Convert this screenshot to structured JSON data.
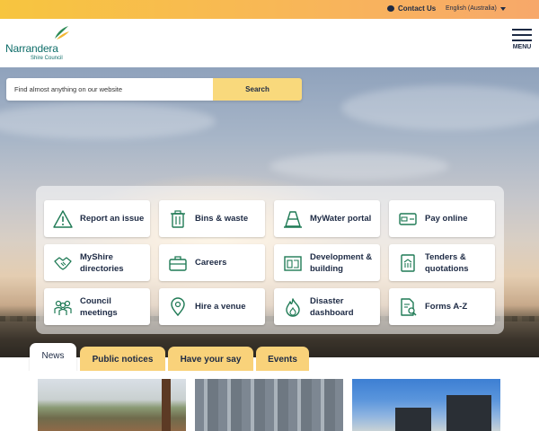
{
  "topbar": {
    "contact_label": "Contact Us",
    "language_label": "English (Australia)"
  },
  "header": {
    "logo_name": "Narrandera",
    "logo_sub": "Shire Council",
    "menu_label": "MENU"
  },
  "search": {
    "placeholder": "Find almost anything on our website",
    "button_label": "Search"
  },
  "quick_links": [
    {
      "label": "Report an issue",
      "icon": "warning-triangle-icon"
    },
    {
      "label": "Bins & waste",
      "icon": "bin-icon"
    },
    {
      "label": "MyWater portal",
      "icon": "traffic-cone-icon"
    },
    {
      "label": "Pay online",
      "icon": "credit-card-icon"
    },
    {
      "label": "MyShire directories",
      "icon": "handshake-icon"
    },
    {
      "label": "Careers",
      "icon": "briefcase-icon"
    },
    {
      "label": "Development & building",
      "icon": "building-plan-icon"
    },
    {
      "label": "Tenders & quotations",
      "icon": "document-building-icon"
    },
    {
      "label": "Council meetings",
      "icon": "people-group-icon"
    },
    {
      "label": "Hire a venue",
      "icon": "location-pin-icon"
    },
    {
      "label": "Disaster dashboard",
      "icon": "flame-icon"
    },
    {
      "label": "Forms A-Z",
      "icon": "document-search-icon"
    }
  ],
  "tabs": [
    {
      "label": "News",
      "active": true
    },
    {
      "label": "Public notices",
      "active": false
    },
    {
      "label": "Have your say",
      "active": false
    },
    {
      "label": "Events",
      "active": false
    }
  ],
  "colors": {
    "accent_yellow": "#f9d27a",
    "brand_teal": "#0e6d69",
    "navy_text": "#1d2a44",
    "icon_green": "#1f7a55"
  }
}
